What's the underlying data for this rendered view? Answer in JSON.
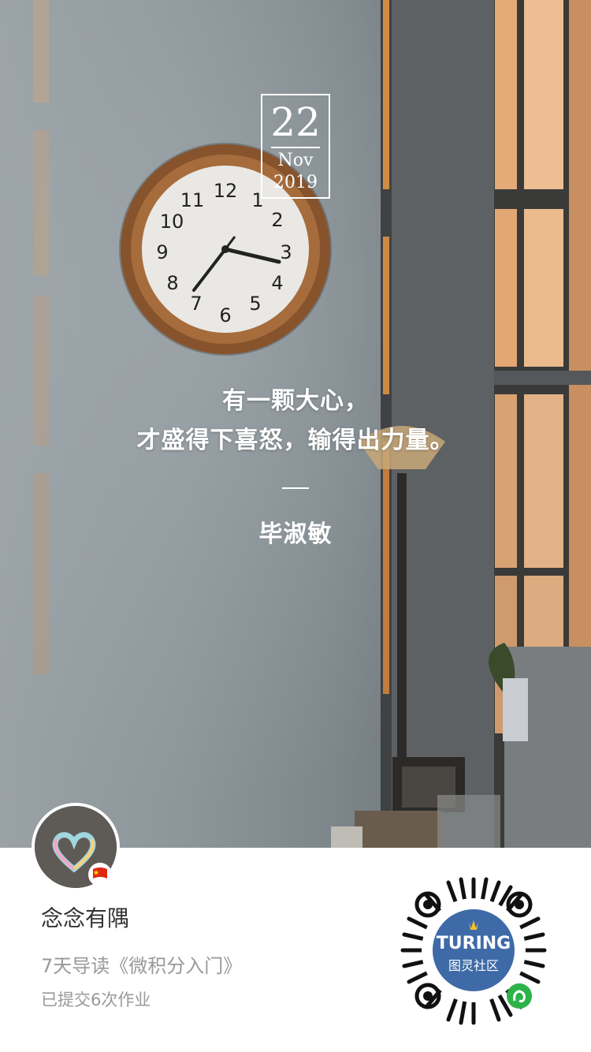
{
  "date": {
    "day": "22",
    "month": "Nov",
    "year": "2019"
  },
  "quote": {
    "line1": "有一颗大心，",
    "line2": "才盛得下喜怒，输得出力量。",
    "author": "毕淑敏"
  },
  "profile": {
    "name": "念念有隅",
    "course": "7天导读《微积分入门》",
    "homework": "已提交6次作业"
  },
  "qr": {
    "brand": "TURING",
    "brand_sub": "图灵社区"
  },
  "colors": {
    "qr_center": "#3e6aa8",
    "wechat_green": "#2db24a"
  }
}
